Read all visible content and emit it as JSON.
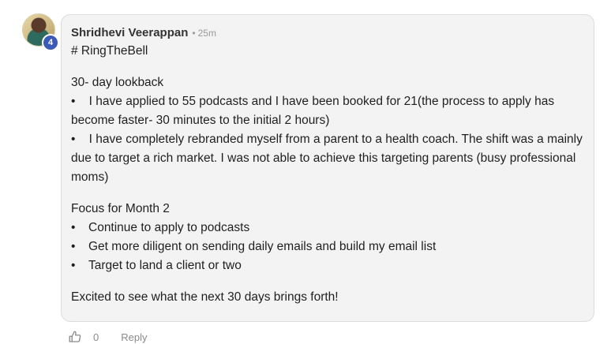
{
  "post": {
    "author": "Shridhevi Veerappan",
    "separator": "•",
    "time": "25m",
    "level": "4",
    "hashtag": "# RingTheBell",
    "lookback_title": "30- day lookback",
    "lookback_items": [
      "I have applied to 55 podcasts and I have been booked for 21(the process to apply has become faster- 30 minutes to the initial 2 hours)",
      "I have completely rebranded myself from a parent to a health coach. The shift was a mainly due to target a rich market. I was not able to achieve this targeting parents (busy professional moms)"
    ],
    "focus_title": "Focus for Month 2",
    "focus_items": [
      "Continue to apply to podcasts",
      "Get more diligent on sending daily emails and build my email list",
      "Target to land a client or two"
    ],
    "closing": "Excited to see what the next 30 days brings forth!",
    "bullet_char": "•"
  },
  "actions": {
    "like_count": "0",
    "reply_label": "Reply"
  },
  "icons": {
    "like": "thumbs-up-icon"
  },
  "colors": {
    "card_bg": "#f3f3f3",
    "badge": "#3c5bb7",
    "meta_text": "#9a9a9a"
  }
}
